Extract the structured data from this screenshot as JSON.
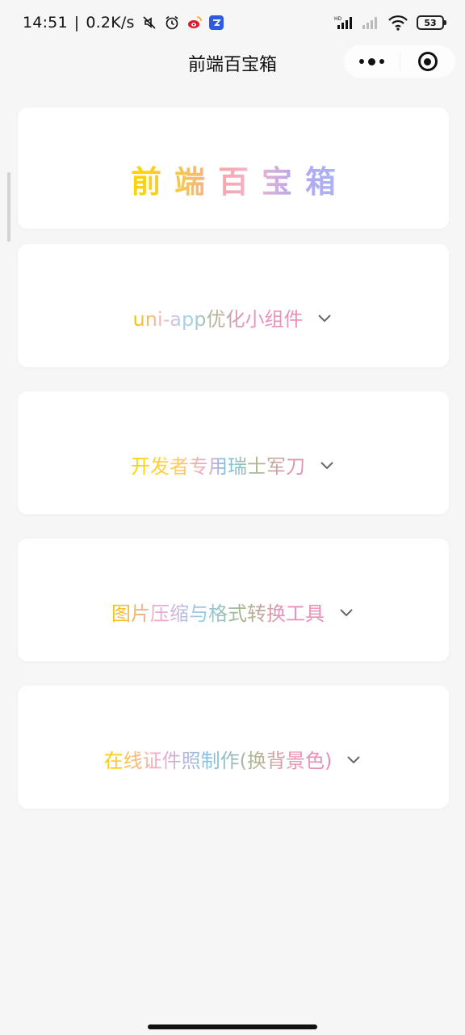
{
  "status_bar": {
    "time": "14:51",
    "network_speed": "0.2K/s",
    "battery_level": "53",
    "icons": [
      "mute-icon",
      "alarm-icon",
      "weibo-icon",
      "app-badge-icon",
      "hd-signal-icon",
      "signal-icon",
      "wifi-icon",
      "battery-icon"
    ]
  },
  "nav": {
    "title": "前端百宝箱",
    "menu_icon": "more-dots-icon",
    "close_icon": "target-circle-icon"
  },
  "header_card": {
    "title": "前端百宝箱"
  },
  "items": [
    {
      "label": "uni-app优化小组件",
      "icon": "chevron-down-icon"
    },
    {
      "label": "开发者专用瑞士军刀",
      "icon": "chevron-down-icon"
    },
    {
      "label": "图片压缩与格式转换工具",
      "icon": "chevron-down-icon"
    },
    {
      "label": "在线证件照制作(换背景色)",
      "icon": "chevron-down-icon"
    }
  ],
  "colors": {
    "background": "#f6f6f6",
    "card": "#ffffff",
    "chevron": "#666666"
  }
}
